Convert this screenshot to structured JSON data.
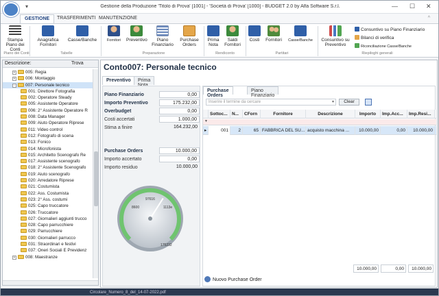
{
  "window": {
    "title": "Gestione della Produzione 'Titolo di Prova' [1001] - 'Società di Prova' [1000] - BUDGET 2.0 by Alfa Software S.r.l.",
    "qat": "▾"
  },
  "ribbon_tabs": [
    "GESTIONE",
    "TRASFERIMENTI",
    "MANUTENZIONE"
  ],
  "ribbon": {
    "buttons": [
      {
        "label": "Stampa Piano dei Conti",
        "icon": "list-icon"
      },
      {
        "label": "Anagrafica Fornitori",
        "icon": "book-icon"
      },
      {
        "label": "Casse/Banche",
        "icon": "book-icon"
      },
      {
        "label": "Fornitori",
        "icon": "person-icon"
      },
      {
        "label": "Preventivo",
        "icon": "person-chart-icon"
      },
      {
        "label": "Piano Finanziario",
        "icon": "document-icon"
      },
      {
        "label": "Purchase Orders",
        "icon": "clipboard-icon"
      },
      {
        "label": "Prima Nota",
        "icon": "book-icon"
      },
      {
        "label": "Saldi Fornitori",
        "icon": "person-icon"
      },
      {
        "label": "Costi",
        "icon": "book-icon"
      },
      {
        "label": "Fornitori",
        "icon": "people-icon"
      },
      {
        "label": "Casse/Banche",
        "icon": "book-icon"
      },
      {
        "label": "Consuntivo su Preventivo",
        "icon": "bar-chart-icon"
      }
    ],
    "small_items": [
      "Consuntivo su Piano Finanziario",
      "Bilanci di verifica",
      "Riconciliazione Casse/Banche"
    ],
    "groups": [
      "Piano dei Conti",
      "Tabelle",
      "Preparazione",
      "Rendiconto",
      "Partitari",
      "Riepiloghi generali"
    ]
  },
  "sidebar": {
    "header": "Descrizione:",
    "search_label": "Trova",
    "items": [
      {
        "label": "005: Regia",
        "level": 1,
        "expander": "+"
      },
      {
        "label": "006: Montaggio",
        "level": 1,
        "expander": "+"
      },
      {
        "label": "007: Personale tecnico",
        "level": 1,
        "expander": "-",
        "selected": true
      },
      {
        "label": "001: Direttore Fotografia",
        "level": 2
      },
      {
        "label": "002: Operatore Steady",
        "level": 2
      },
      {
        "label": "005: Assistente Operatore",
        "level": 2
      },
      {
        "label": "006: 2° Assistente Operatore R",
        "level": 2
      },
      {
        "label": "008: Data Manager",
        "level": 2
      },
      {
        "label": "009: Aiuto Operatore Riprese",
        "level": 2
      },
      {
        "label": "011: Video control",
        "level": 2
      },
      {
        "label": "012: Fotografo di scena",
        "level": 2
      },
      {
        "label": "013: Fonico",
        "level": 2
      },
      {
        "label": "014: Microfonista",
        "level": 2
      },
      {
        "label": "015: Architetto Scenografo Re",
        "level": 2
      },
      {
        "label": "017: Assistente scenografo",
        "level": 2
      },
      {
        "label": "018: 2° Assistente Scenografo",
        "level": 2
      },
      {
        "label": "019: Aiuto scenografo",
        "level": 2
      },
      {
        "label": "020: Arredatore Riprese",
        "level": 2
      },
      {
        "label": "021: Costumista",
        "level": 2
      },
      {
        "label": "022: Ass. Costumista",
        "level": 2
      },
      {
        "label": "023: 2° Ass. costumi",
        "level": 2
      },
      {
        "label": "025: Capo truccatore",
        "level": 2
      },
      {
        "label": "026: Truccatore",
        "level": 2
      },
      {
        "label": "027: Giornalieri aggiunti trucco",
        "level": 2
      },
      {
        "label": "028: Capo parrucchiere",
        "level": 2
      },
      {
        "label": "029: Parrucchiere",
        "level": 2
      },
      {
        "label": "030: Giornalieri parrucco",
        "level": 2
      },
      {
        "label": "031: Straordinari e festivi",
        "level": 2
      },
      {
        "label": "037: Oneri Sociali E Previdenz",
        "level": 2
      },
      {
        "label": "008: Maestranze",
        "level": 1,
        "expander": "+"
      }
    ]
  },
  "main": {
    "title": "Conto007: Personale tecnico",
    "tabs": [
      "Preventivo",
      "Prima Nota"
    ],
    "fields": [
      {
        "label": "Piano Finanziario",
        "value": "0,00",
        "bold": true
      },
      {
        "label": "Importo Preventivo",
        "value": "175.232,00",
        "bold": true
      },
      {
        "label": "Overbudget",
        "value": "0,00",
        "bold": true
      },
      {
        "label": "Costi accertati",
        "value": "1.000,00",
        "bold": false
      },
      {
        "label": "Stima a finire",
        "value": "164.232,00",
        "bold": false
      }
    ],
    "po_fields": [
      {
        "label": "Purchase Orders",
        "value": "10.000,00",
        "bold": true
      },
      {
        "label": "Importo accertato",
        "value": "0,00",
        "bold": false
      },
      {
        "label": "Importo residuo",
        "value": "10.000,00",
        "bold": false
      }
    ],
    "gauge": {
      "labels": [
        "97616",
        "1113e",
        "8600",
        "175232"
      ],
      "value_fraction": 0.62
    },
    "panel_tabs": [
      "Purchase Orders",
      "Piano Finanziario"
    ],
    "search_placeholder": "Inserire il termine da cercare",
    "clear_label": "Clear",
    "grid": {
      "columns": [
        "Sottoc...",
        "N...",
        "CForn",
        "Fornitore",
        "Descrizione",
        "Importo",
        "Imp.Acc...",
        "Imp.Resi..."
      ],
      "rows": [
        [
          "001",
          "2",
          "65",
          "FABBRICA DEL SU...",
          "acquisto macchina ...",
          "10.000,00",
          "0,00",
          "10.000,00"
        ]
      ],
      "totals": [
        "10.000,00",
        "0,00",
        "10.000,00"
      ]
    },
    "new_po_label": "Nuovo Purchase Order"
  },
  "taskbar": {
    "text": "Circolare_Numero_8_del_14-07-2022.pdf"
  },
  "colors": {
    "accent": "#1b3f7d",
    "selection": "#cfe3f8",
    "grid_selection": "#d7e7f8",
    "folder": "#f0c74f"
  }
}
